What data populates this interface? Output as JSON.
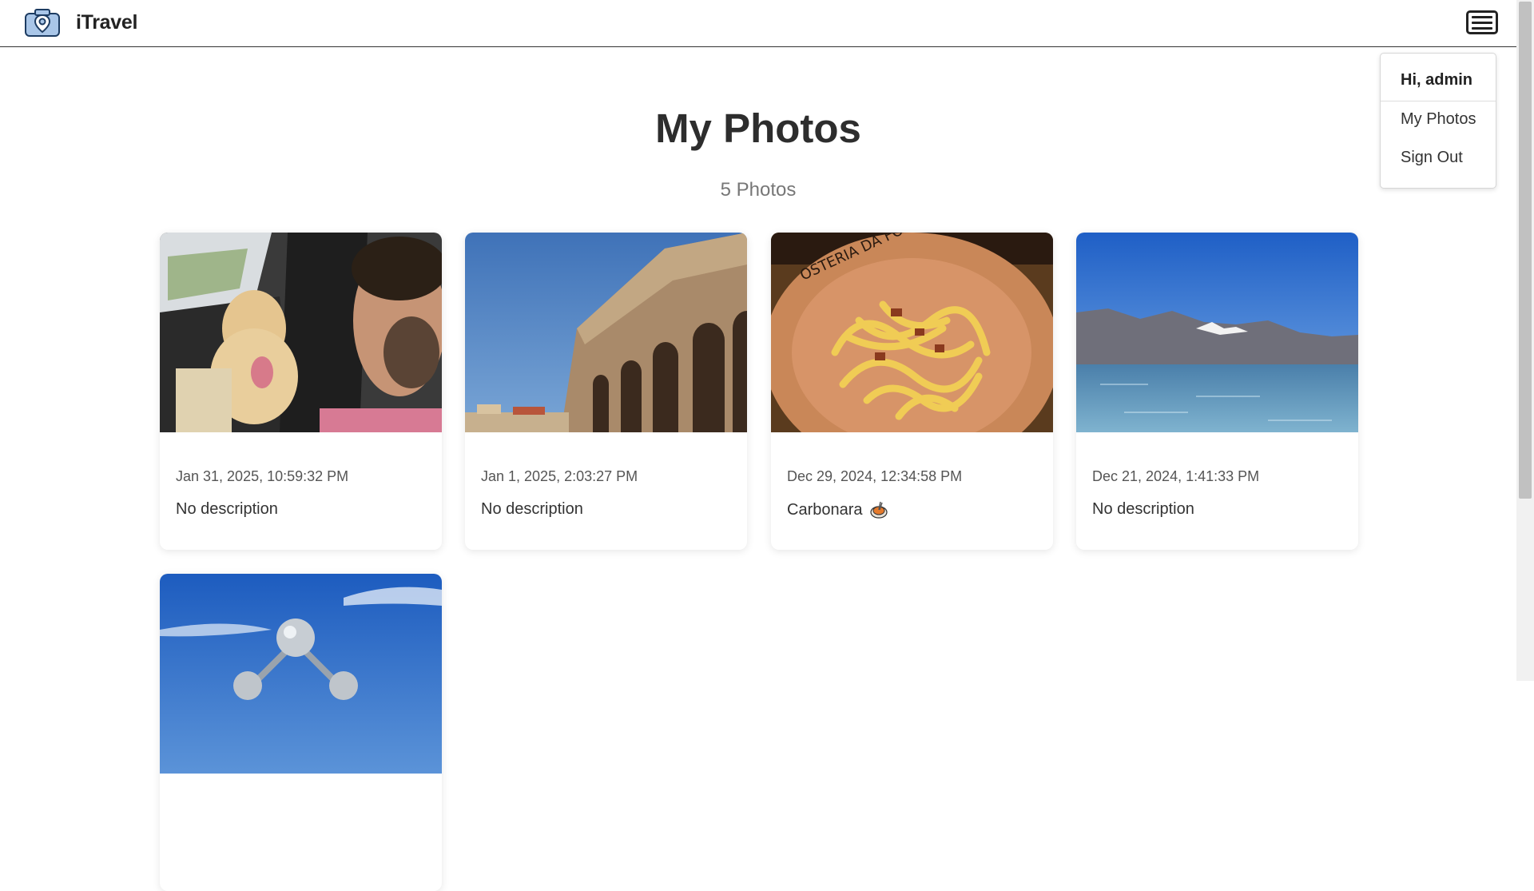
{
  "app": {
    "name": "iTravel"
  },
  "nav": {
    "logo_icon": "camera-location-icon",
    "menu_icon": "hamburger-menu-icon"
  },
  "dropdown": {
    "greeting": "Hi, admin",
    "items": [
      {
        "label": "My Photos"
      },
      {
        "label": "Sign Out"
      }
    ]
  },
  "page": {
    "title": "My Photos",
    "count": "5 Photos"
  },
  "photos": [
    {
      "date": "Jan 31, 2025, 10:59:32 PM",
      "description": "No description",
      "image": "selfie-with-dog-in-car"
    },
    {
      "date": "Jan 1, 2025, 2:03:27 PM",
      "description": "No description",
      "image": "ancient-arena-arches"
    },
    {
      "date": "Dec 29, 2024, 12:34:58 PM",
      "description": "Carbonara",
      "description_icon": "spaghetti-emoji-icon",
      "image": "carbonara-plate"
    },
    {
      "date": "Dec 21, 2024, 1:41:33 PM",
      "description": "No description",
      "image": "lake-and-mountains"
    },
    {
      "date": "",
      "description": "",
      "image": "atomium-blue-sky"
    }
  ],
  "colors": {
    "accent": "#2f6fb0",
    "text": "#333333",
    "muted": "#777777"
  }
}
